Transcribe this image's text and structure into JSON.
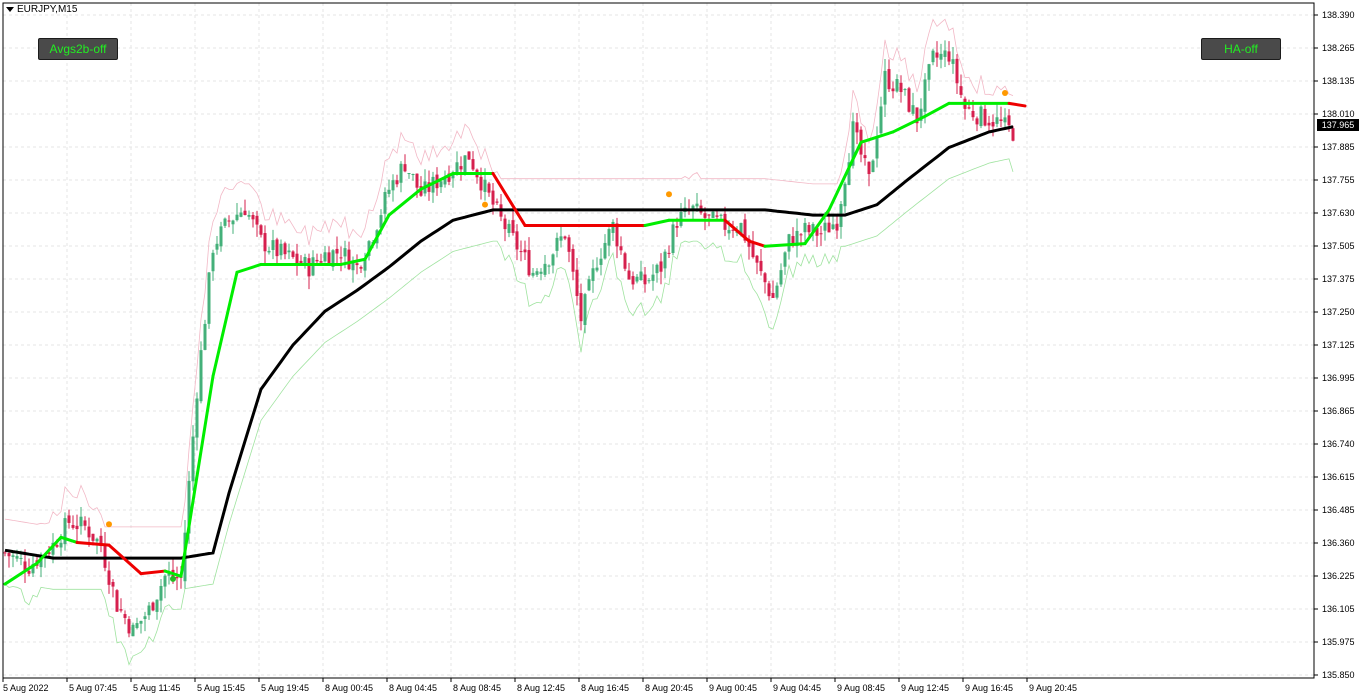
{
  "header": {
    "symbol_label": "EURJPY,M15",
    "dropdown_icon": "triangle-down-icon"
  },
  "buttons": {
    "avgs_label": "Avgs2b-off",
    "ha_label": "HA-off",
    "text_color": "#22ee22",
    "bg_color": "#4a4a4a"
  },
  "current_price": "137.965",
  "colors": {
    "bull": "#44b07a",
    "bear": "#d6204e",
    "trend_up": "#00ee00",
    "trend_down": "#ee0000",
    "baseline": "#000000",
    "dots": "#ff9900",
    "grid": "#e6e6e6"
  },
  "chart_data": {
    "type": "candlestick",
    "title": "",
    "y_ticks": [
      "138.390",
      "138.265",
      "138.135",
      "138.010",
      "137.885",
      "137.755",
      "137.630",
      "137.505",
      "137.375",
      "137.250",
      "137.125",
      "136.995",
      "136.865",
      "136.740",
      "136.615",
      "136.485",
      "136.360",
      "136.225",
      "136.105",
      "135.975",
      "135.850"
    ],
    "ylim": [
      135.85,
      138.39
    ],
    "x_ticks": [
      "5 Aug 2022",
      "5 Aug 07:45",
      "5 Aug 11:45",
      "5 Aug 15:45",
      "5 Aug 19:45",
      "8 Aug 00:45",
      "8 Aug 04:45",
      "8 Aug 08:45",
      "8 Aug 12:45",
      "8 Aug 16:45",
      "8 Aug 20:45",
      "9 Aug 00:45",
      "9 Aug 04:45",
      "9 Aug 08:45",
      "9 Aug 12:45",
      "9 Aug 16:45",
      "9 Aug 20:45"
    ],
    "bars_per_tick": 16,
    "close_anchors": [
      [
        0,
        136.32
      ],
      [
        6,
        136.27
      ],
      [
        12,
        136.35
      ],
      [
        16,
        136.44
      ],
      [
        20,
        136.42
      ],
      [
        24,
        136.35
      ],
      [
        28,
        136.12
      ],
      [
        32,
        136.02
      ],
      [
        36,
        136.1
      ],
      [
        40,
        136.23
      ],
      [
        44,
        136.22
      ],
      [
        48,
        136.95
      ],
      [
        52,
        137.5
      ],
      [
        56,
        137.6
      ],
      [
        60,
        137.65
      ],
      [
        64,
        137.52
      ],
      [
        68,
        137.48
      ],
      [
        72,
        137.45
      ],
      [
        76,
        137.42
      ],
      [
        80,
        137.47
      ],
      [
        84,
        137.48
      ],
      [
        88,
        137.42
      ],
      [
        92,
        137.55
      ],
      [
        96,
        137.72
      ],
      [
        100,
        137.82
      ],
      [
        104,
        137.7
      ],
      [
        108,
        137.75
      ],
      [
        112,
        137.8
      ],
      [
        116,
        137.85
      ],
      [
        120,
        137.72
      ],
      [
        124,
        137.6
      ],
      [
        128,
        137.5
      ],
      [
        132,
        137.4
      ],
      [
        136,
        137.46
      ],
      [
        140,
        137.55
      ],
      [
        144,
        137.22
      ],
      [
        148,
        137.45
      ],
      [
        152,
        137.58
      ],
      [
        156,
        137.38
      ],
      [
        160,
        137.36
      ],
      [
        164,
        137.42
      ],
      [
        168,
        137.6
      ],
      [
        172,
        137.64
      ],
      [
        176,
        137.6
      ],
      [
        180,
        137.58
      ],
      [
        184,
        137.58
      ],
      [
        188,
        137.42
      ],
      [
        192,
        137.3
      ],
      [
        196,
        137.52
      ],
      [
        200,
        137.56
      ],
      [
        204,
        137.55
      ],
      [
        208,
        137.6
      ],
      [
        212,
        137.95
      ],
      [
        216,
        137.75
      ],
      [
        220,
        138.15
      ],
      [
        224,
        138.1
      ],
      [
        228,
        137.99
      ],
      [
        232,
        138.22
      ],
      [
        236,
        138.24
      ],
      [
        240,
        138.03
      ],
      [
        244,
        138.0
      ],
      [
        248,
        137.98
      ],
      [
        252,
        137.94
      ]
    ],
    "trend_line": [
      [
        0,
        136.2,
        "up"
      ],
      [
        8,
        136.28,
        "up"
      ],
      [
        14,
        136.38,
        "up"
      ],
      [
        18,
        136.36,
        "down"
      ],
      [
        26,
        136.35,
        "down"
      ],
      [
        34,
        136.24,
        "down"
      ],
      [
        40,
        136.25,
        "up"
      ],
      [
        44,
        136.23,
        "up"
      ],
      [
        52,
        137.0,
        "up"
      ],
      [
        58,
        137.4,
        "up"
      ],
      [
        64,
        137.43,
        "up"
      ],
      [
        84,
        137.43,
        "up"
      ],
      [
        90,
        137.45,
        "up"
      ],
      [
        96,
        137.62,
        "up"
      ],
      [
        104,
        137.72,
        "up"
      ],
      [
        112,
        137.78,
        "up"
      ],
      [
        122,
        137.78,
        "down"
      ],
      [
        130,
        137.58,
        "down"
      ],
      [
        160,
        137.58,
        "up"
      ],
      [
        166,
        137.6,
        "up"
      ],
      [
        180,
        137.6,
        "down"
      ],
      [
        186,
        137.52,
        "down"
      ],
      [
        190,
        137.5,
        "up"
      ],
      [
        200,
        137.51,
        "up"
      ],
      [
        206,
        137.64,
        "up"
      ],
      [
        214,
        137.9,
        "up"
      ],
      [
        222,
        137.94,
        "up"
      ],
      [
        230,
        138.0,
        "up"
      ],
      [
        236,
        138.05,
        "up"
      ],
      [
        251,
        138.05,
        "down"
      ],
      [
        255,
        138.04,
        "down"
      ]
    ],
    "baseline_ma": [
      [
        0,
        136.33
      ],
      [
        12,
        136.3
      ],
      [
        44,
        136.3
      ],
      [
        52,
        136.32
      ],
      [
        56,
        136.55
      ],
      [
        64,
        136.95
      ],
      [
        72,
        137.12
      ],
      [
        80,
        137.25
      ],
      [
        88,
        137.33
      ],
      [
        96,
        137.42
      ],
      [
        104,
        137.52
      ],
      [
        112,
        137.6
      ],
      [
        122,
        137.64
      ],
      [
        130,
        137.64
      ],
      [
        160,
        137.64
      ],
      [
        190,
        137.64
      ],
      [
        202,
        137.62
      ],
      [
        210,
        137.62
      ],
      [
        218,
        137.66
      ],
      [
        226,
        137.76
      ],
      [
        236,
        137.88
      ],
      [
        246,
        137.94
      ],
      [
        255,
        137.97
      ]
    ],
    "signal_dots": [
      [
        26,
        136.43
      ],
      [
        120,
        137.66
      ],
      [
        166,
        137.7
      ],
      [
        250,
        138.09
      ]
    ],
    "green_dot": [
      42,
      136.22
    ]
  }
}
